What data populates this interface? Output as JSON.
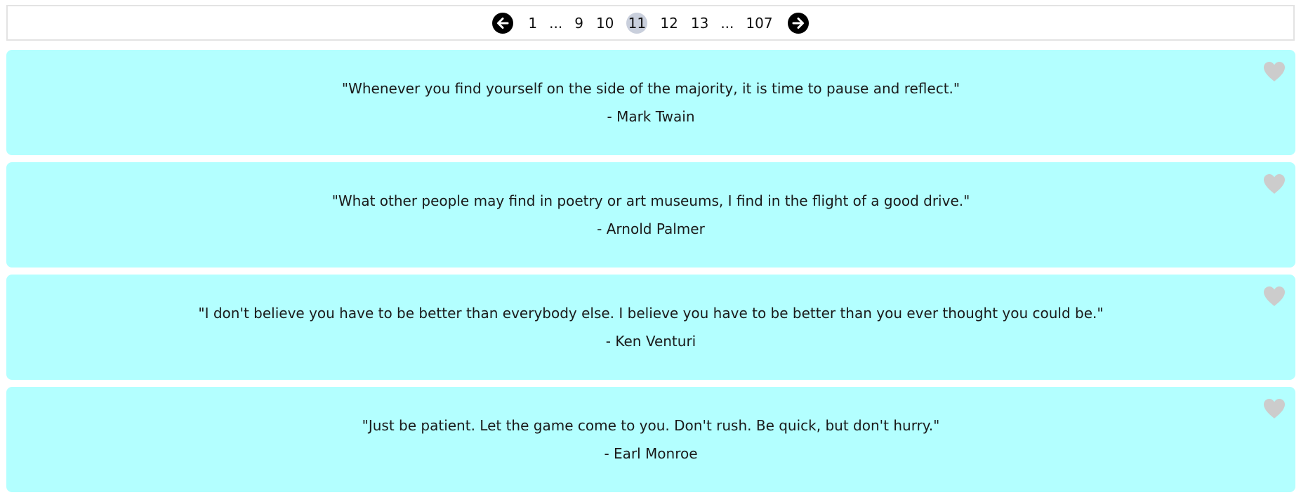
{
  "pagination": {
    "prev_icon": "arrow-left-icon",
    "next_icon": "arrow-right-icon",
    "items": [
      {
        "label": "1",
        "current": false
      },
      {
        "label": "...",
        "current": false,
        "ellipsis": true
      },
      {
        "label": "9",
        "current": false
      },
      {
        "label": "10",
        "current": false
      },
      {
        "label": "11",
        "current": true
      },
      {
        "label": "12",
        "current": false
      },
      {
        "label": "13",
        "current": false
      },
      {
        "label": "...",
        "current": false,
        "ellipsis": true
      },
      {
        "label": "107",
        "current": false
      }
    ]
  },
  "quotes": [
    {
      "text": "\"Whenever you find yourself on the side of the majority, it is time to pause and reflect.\"",
      "author": "- Mark Twain",
      "icon": "heart-icon"
    },
    {
      "text": "\"What other people may find in poetry or art museums, I find in the flight of a good drive.\"",
      "author": "- Arnold Palmer",
      "icon": "heart-icon"
    },
    {
      "text": "\"I don't believe you have to be better than everybody else. I believe you have to be better than you ever thought you could be.\"",
      "author": "- Ken Venturi",
      "icon": "heart-icon"
    },
    {
      "text": "\"Just be patient. Let the game come to you. Don't rush. Be quick, but don't hurry.\"",
      "author": "- Earl Monroe",
      "icon": "heart-icon"
    }
  ],
  "colors": {
    "card_background": "#b3ffff",
    "current_page_background": "#c9cfdc",
    "heart": "#cccccc",
    "arrow": "#000000"
  }
}
